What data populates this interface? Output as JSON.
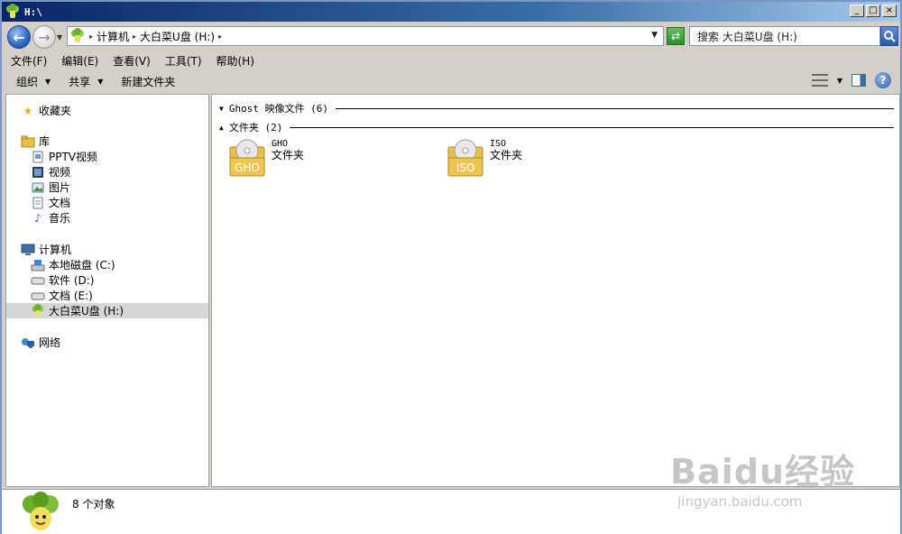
{
  "window": {
    "title": "H:\\"
  },
  "window_buttons": {
    "minimize": "_",
    "maximize": "□",
    "close": "×"
  },
  "nav": {
    "back": "←",
    "forward": "→"
  },
  "address": {
    "breadcrumbs": [
      "计算机",
      "大白菜U盘 (H:)"
    ]
  },
  "search": {
    "placeholder": "搜索 大白菜U盘 (H:)"
  },
  "menu": [
    "文件(F)",
    "编辑(E)",
    "查看(V)",
    "工具(T)",
    "帮助(H)"
  ],
  "toolbar": {
    "organize": "组织",
    "share": "共享",
    "new_folder": "新建文件夹"
  },
  "sidebar": {
    "favorites": "收藏夹",
    "library": "库",
    "library_items": [
      "PPTV视频",
      "视频",
      "图片",
      "文档",
      "音乐"
    ],
    "computer": "计算机",
    "drives": [
      "本地磁盘 (C:)",
      "软件 (D:)",
      "文档 (E:)",
      "大白菜U盘 (H:)"
    ],
    "network": "网络"
  },
  "groups": [
    {
      "label": "Ghost 映像文件 (6)",
      "expanded": false
    },
    {
      "label": "文件夹 (2)",
      "expanded": true
    }
  ],
  "folders": [
    {
      "name": "GHO",
      "type": "文件夹",
      "badge": "GHO"
    },
    {
      "name": "ISO",
      "type": "文件夹",
      "badge": "ISO"
    }
  ],
  "status": {
    "count": "8 个对象"
  },
  "watermark": {
    "main": "Baidu经验",
    "sub": "jingyan.baidu.com"
  },
  "colors": {
    "title_bar": "#0a246a",
    "selected": "#d6d6d6",
    "folder": "#e8c04a"
  }
}
